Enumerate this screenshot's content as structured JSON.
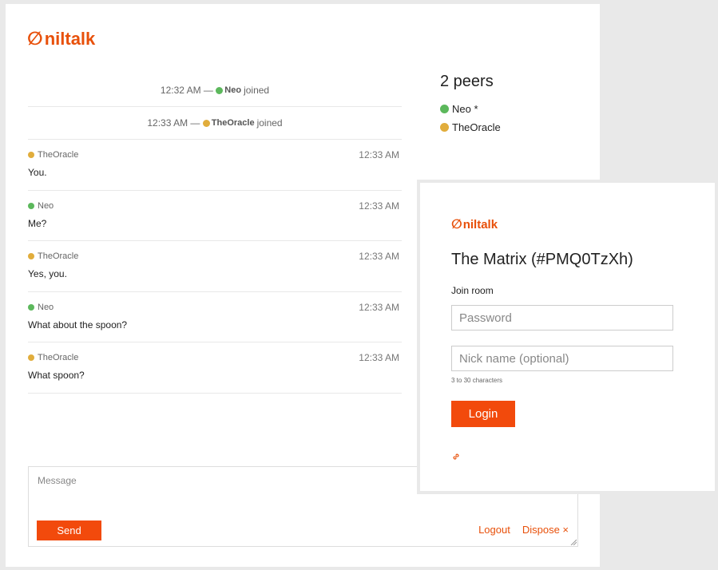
{
  "brand": {
    "name": "niltalk",
    "glyph": "∅"
  },
  "colors": {
    "accent": "#f24a0c",
    "neo": "#5cb85c",
    "oracle": "#e1ad3c"
  },
  "feed": {
    "system": [
      {
        "time": "12:32 AM —",
        "nick": "Neo",
        "color": "green",
        "action": "joined"
      },
      {
        "time": "12:33 AM —",
        "nick": "TheOracle",
        "color": "yellow",
        "action": "joined"
      }
    ],
    "messages": [
      {
        "nick": "TheOracle",
        "color": "yellow",
        "time": "12:33 AM",
        "text": "You."
      },
      {
        "nick": "Neo",
        "color": "green",
        "time": "12:33 AM",
        "text": "Me?"
      },
      {
        "nick": "TheOracle",
        "color": "yellow",
        "time": "12:33 AM",
        "text": "Yes, you."
      },
      {
        "nick": "Neo",
        "color": "green",
        "time": "12:33 AM",
        "text": "What about the spoon?"
      },
      {
        "nick": "TheOracle",
        "color": "yellow",
        "time": "12:33 AM",
        "text": "What spoon?"
      }
    ]
  },
  "peers": {
    "title": "2 peers",
    "list": [
      {
        "name": "Neo *",
        "color": "green"
      },
      {
        "name": "TheOracle",
        "color": "yellow"
      }
    ]
  },
  "composer": {
    "placeholder": "Message",
    "send_label": "Send",
    "logout_label": "Logout",
    "dispose_label": "Dispose ×"
  },
  "login": {
    "room_title": "The Matrix (#PMQ0TzXh)",
    "join_label": "Join room",
    "password_placeholder": "Password",
    "nick_placeholder": "Nick name (optional)",
    "nick_hint": "3 to 30 characters",
    "login_label": "Login",
    "link_icon": "link-icon"
  }
}
